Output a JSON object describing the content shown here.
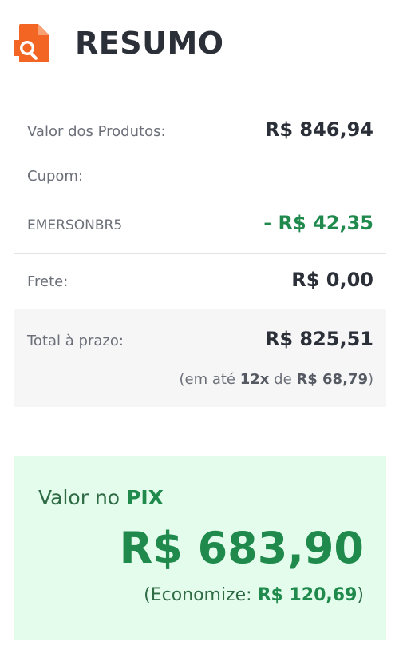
{
  "header": {
    "title": "RESUMO",
    "icon": "document-search-icon",
    "icon_color": "#f26522"
  },
  "summary": {
    "products_label": "Valor dos Produtos:",
    "products_value": "R$ 846,94",
    "coupon_label": "Cupom:",
    "coupon_code": "EMERSONBR5",
    "coupon_discount": "- R$ 42,35",
    "shipping_label": "Frete:",
    "shipping_value": "R$ 0,00"
  },
  "total": {
    "label": "Total à prazo:",
    "value": "R$ 825,51",
    "installments_prefix": "(em até",
    "installments_count": "12x",
    "installments_middle": "de",
    "installments_value": "R$ 68,79",
    "installments_suffix": ")"
  },
  "pix": {
    "label_prefix": "Valor no",
    "label_bold": "PIX",
    "value": "R$ 683,90",
    "save_prefix": "(Economize:",
    "save_value": "R$ 120,69",
    "save_suffix": ")"
  },
  "colors": {
    "accent": "#f26522",
    "green": "#1f8a4c",
    "pix_bg": "#e3fcec",
    "text_dark": "#2b2f38"
  }
}
